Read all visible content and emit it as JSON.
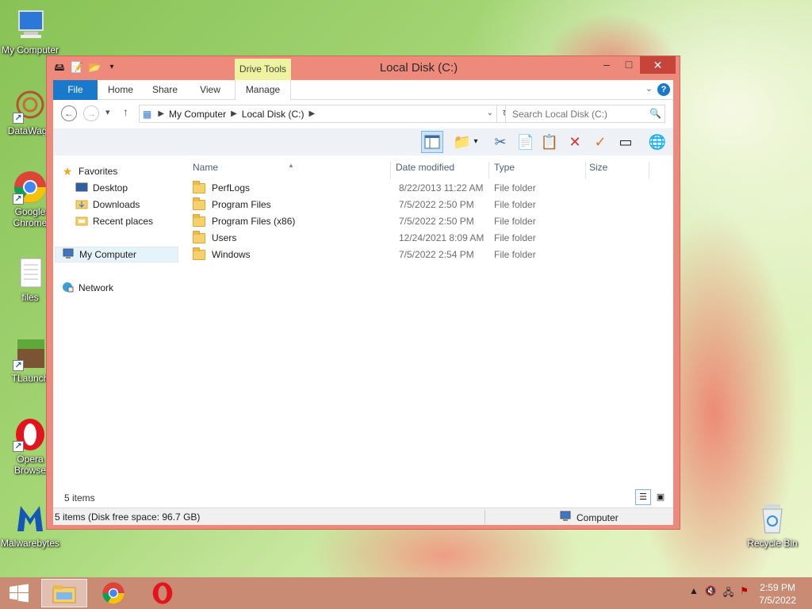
{
  "desktop": {
    "icons": [
      {
        "label": "My Computer",
        "icon": "computer-icon"
      },
      {
        "label": "DataWago",
        "icon": "datawago-icon"
      },
      {
        "label": "Google Chrome",
        "icon": "chrome-icon"
      },
      {
        "label": "files",
        "icon": "text-file-icon"
      },
      {
        "label": "TLaunch",
        "icon": "minecraft-icon"
      },
      {
        "label": "Opera Browse",
        "icon": "opera-icon"
      },
      {
        "label": "Malwarebytes",
        "icon": "malwarebytes-icon"
      },
      {
        "label": "Recycle Bin",
        "icon": "recycle-bin-icon"
      }
    ]
  },
  "window": {
    "title": "Local Disk (C:)",
    "contextual_tab": "Drive Tools",
    "controls": {
      "minimize": "–",
      "maximize": "□",
      "close": "✕"
    }
  },
  "ribbon": {
    "tabs": [
      "File",
      "Home",
      "Share",
      "View",
      "Manage"
    ],
    "help": "?"
  },
  "navbar": {
    "breadcrumb": [
      "My Computer",
      "Local Disk (C:)"
    ],
    "search_placeholder": "Search Local Disk (C:)"
  },
  "toolbar": {
    "buttons": [
      "preview-pane",
      "folder-options",
      "cut",
      "copy",
      "paste",
      "delete",
      "properties",
      "rename",
      "network"
    ]
  },
  "navpane": {
    "favorites": "Favorites",
    "desktop": "Desktop",
    "downloads": "Downloads",
    "recent": "Recent places",
    "computer": "My Computer",
    "network": "Network"
  },
  "content": {
    "columns": [
      "Name",
      "Date modified",
      "Type",
      "Size"
    ],
    "rows": [
      {
        "name": "PerfLogs",
        "date": "8/22/2013 11:22 AM",
        "type": "File folder"
      },
      {
        "name": "Program Files",
        "date": "7/5/2022 2:50 PM",
        "type": "File folder"
      },
      {
        "name": "Program Files (x86)",
        "date": "7/5/2022 2:50 PM",
        "type": "File folder"
      },
      {
        "name": "Users",
        "date": "12/24/2021 8:09 AM",
        "type": "File folder"
      },
      {
        "name": "Windows",
        "date": "7/5/2022 2:54 PM",
        "type": "File folder"
      }
    ],
    "items_count": "5 items"
  },
  "statusbar": {
    "left": "5 items (Disk free space: 96.7 GB)",
    "right": "Computer"
  },
  "taskbar": {
    "time": "2:59 PM",
    "date": "7/5/2022"
  }
}
